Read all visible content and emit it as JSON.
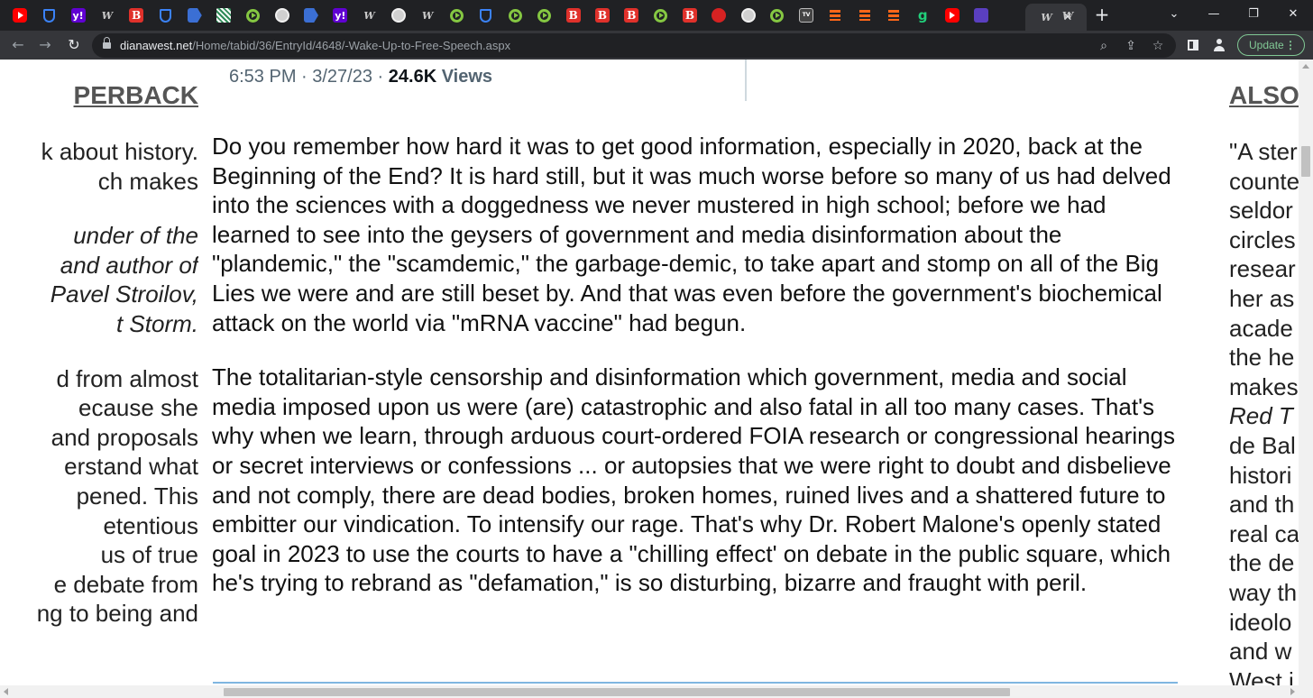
{
  "browser": {
    "tabs": [
      {
        "icon": "youtube-icon",
        "glyph": ""
      },
      {
        "icon": "shield-icon",
        "glyph": ""
      },
      {
        "icon": "yahoo-icon",
        "glyph": "y!"
      },
      {
        "icon": "ww-icon",
        "glyph": "W"
      },
      {
        "icon": "breitbart-icon",
        "glyph": "B"
      },
      {
        "icon": "shield-icon",
        "glyph": ""
      },
      {
        "icon": "flag-icon",
        "glyph": ""
      },
      {
        "icon": "pattern-icon",
        "glyph": ""
      },
      {
        "icon": "rumble-icon",
        "glyph": ""
      },
      {
        "icon": "globe-icon",
        "glyph": ""
      },
      {
        "icon": "flag-icon",
        "glyph": ""
      },
      {
        "icon": "yahoo-icon",
        "glyph": "y!"
      },
      {
        "icon": "ww-icon",
        "glyph": "W"
      },
      {
        "icon": "globe-icon",
        "glyph": ""
      },
      {
        "icon": "ww-icon",
        "glyph": "W"
      },
      {
        "icon": "rumble-icon",
        "glyph": ""
      },
      {
        "icon": "shield-icon",
        "glyph": ""
      },
      {
        "icon": "rumble-icon",
        "glyph": ""
      },
      {
        "icon": "rumble-icon",
        "glyph": ""
      },
      {
        "icon": "breitbart-icon",
        "glyph": "B"
      },
      {
        "icon": "breitbart-icon",
        "glyph": "B"
      },
      {
        "icon": "breitbart-icon",
        "glyph": "B"
      },
      {
        "icon": "rumble-icon",
        "glyph": ""
      },
      {
        "icon": "breitbart-icon",
        "glyph": "B"
      },
      {
        "icon": "microphone-icon",
        "glyph": ""
      },
      {
        "icon": "globe-icon",
        "glyph": ""
      },
      {
        "icon": "rumble-icon",
        "glyph": ""
      },
      {
        "icon": "tv-icon",
        "glyph": "TV"
      },
      {
        "icon": "substack-icon",
        "glyph": ""
      },
      {
        "icon": "substack-icon",
        "glyph": ""
      },
      {
        "icon": "substack-icon",
        "glyph": ""
      },
      {
        "icon": "gab-icon",
        "glyph": "g"
      },
      {
        "icon": "youtube-icon",
        "glyph": ""
      },
      {
        "icon": "envelope-icon",
        "glyph": ""
      }
    ],
    "active_tab": {
      "icon": "ww-icon",
      "glyph": "W",
      "close_glyph": "✕"
    },
    "after_active_tab": {
      "icon": "ww-icon",
      "glyph": "W"
    },
    "new_tab_glyph": "+",
    "window_controls": {
      "dropdown": "⌄",
      "minimize": "—",
      "restore": "❐",
      "close": "✕"
    },
    "nav": {
      "back": "←",
      "forward": "→",
      "reload": "↻"
    },
    "url_host": "dianawest.net",
    "url_path": "/Home/tabid/36/EntryId/4648/-Wake-Up-to-Free-Speech.aspx",
    "omnibox_icons": {
      "zoom": "⌕",
      "share": "⇪",
      "bookmark": "☆"
    },
    "update_label": "Update",
    "update_menu_glyph": "⋮"
  },
  "page": {
    "tweet_meta": {
      "time_date": "6:53 PM · 3/27/23 · ",
      "views_count": "24.6K",
      "views_label": " Views"
    },
    "left_column": {
      "heading": "PERBACK",
      "block1": [
        "k about history.",
        "ch makes"
      ],
      "block2_italic": [
        "under of the",
        "and author of",
        "Pavel Stroilov,",
        "t Storm."
      ],
      "block3": [
        "d from almost",
        "ecause she",
        "and proposals",
        "erstand what",
        "pened. This",
        "etentious",
        "us of true",
        "e debate from",
        "ng to being and"
      ]
    },
    "article": {
      "paragraphs": [
        "Do you remember how hard it was to get good information, especially in 2020, back at the Beginning of the End? It is hard still, but it was much worse before so many of us had delved into the sciences with a doggedness we never mustered in high school; before we had learned to see into the geysers of government and media disinformation about the \"plandemic,\" the \"scamdemic,\" the garbage-demic, to take apart and stomp on all of the Big Lies we were and are still beset by. And that was even before the government's biochemical attack on the world via \"mRNA vaccine\" had begun.",
        "The totalitarian-style censorship and disinformation which government, media and social media imposed upon us were (are) catastrophic and also fatal in all too many cases. That's why when we learn, through arduous court-ordered FOIA research or congressional hearings or secret interviews or confessions ... or autopsies that we were right to doubt and disbelieve and not comply, there are dead bodies, broken homes, ruined lives and a shattered future to embitter our vindication. To intensify our rage. That's why Dr. Robert Malone's openly stated goal in 2023 to use the courts to have a \"chilling effect' on debate in the public square, which he's trying to rebrand as \"defamation,\" is so disturbing, bizarre and fraught with peril."
      ]
    },
    "right_column": {
      "heading": "ALSO",
      "lines": [
        "\"A ster",
        "counte",
        "seldor",
        "circles",
        "resear",
        "her as",
        "acade",
        "the he",
        "makes"
      ],
      "italic_line": "Red T",
      "lines2": [
        "de Bal",
        "histori",
        "and th",
        "real ca",
        "the de",
        "way th",
        "ideolo",
        "and w",
        "West i"
      ]
    }
  }
}
